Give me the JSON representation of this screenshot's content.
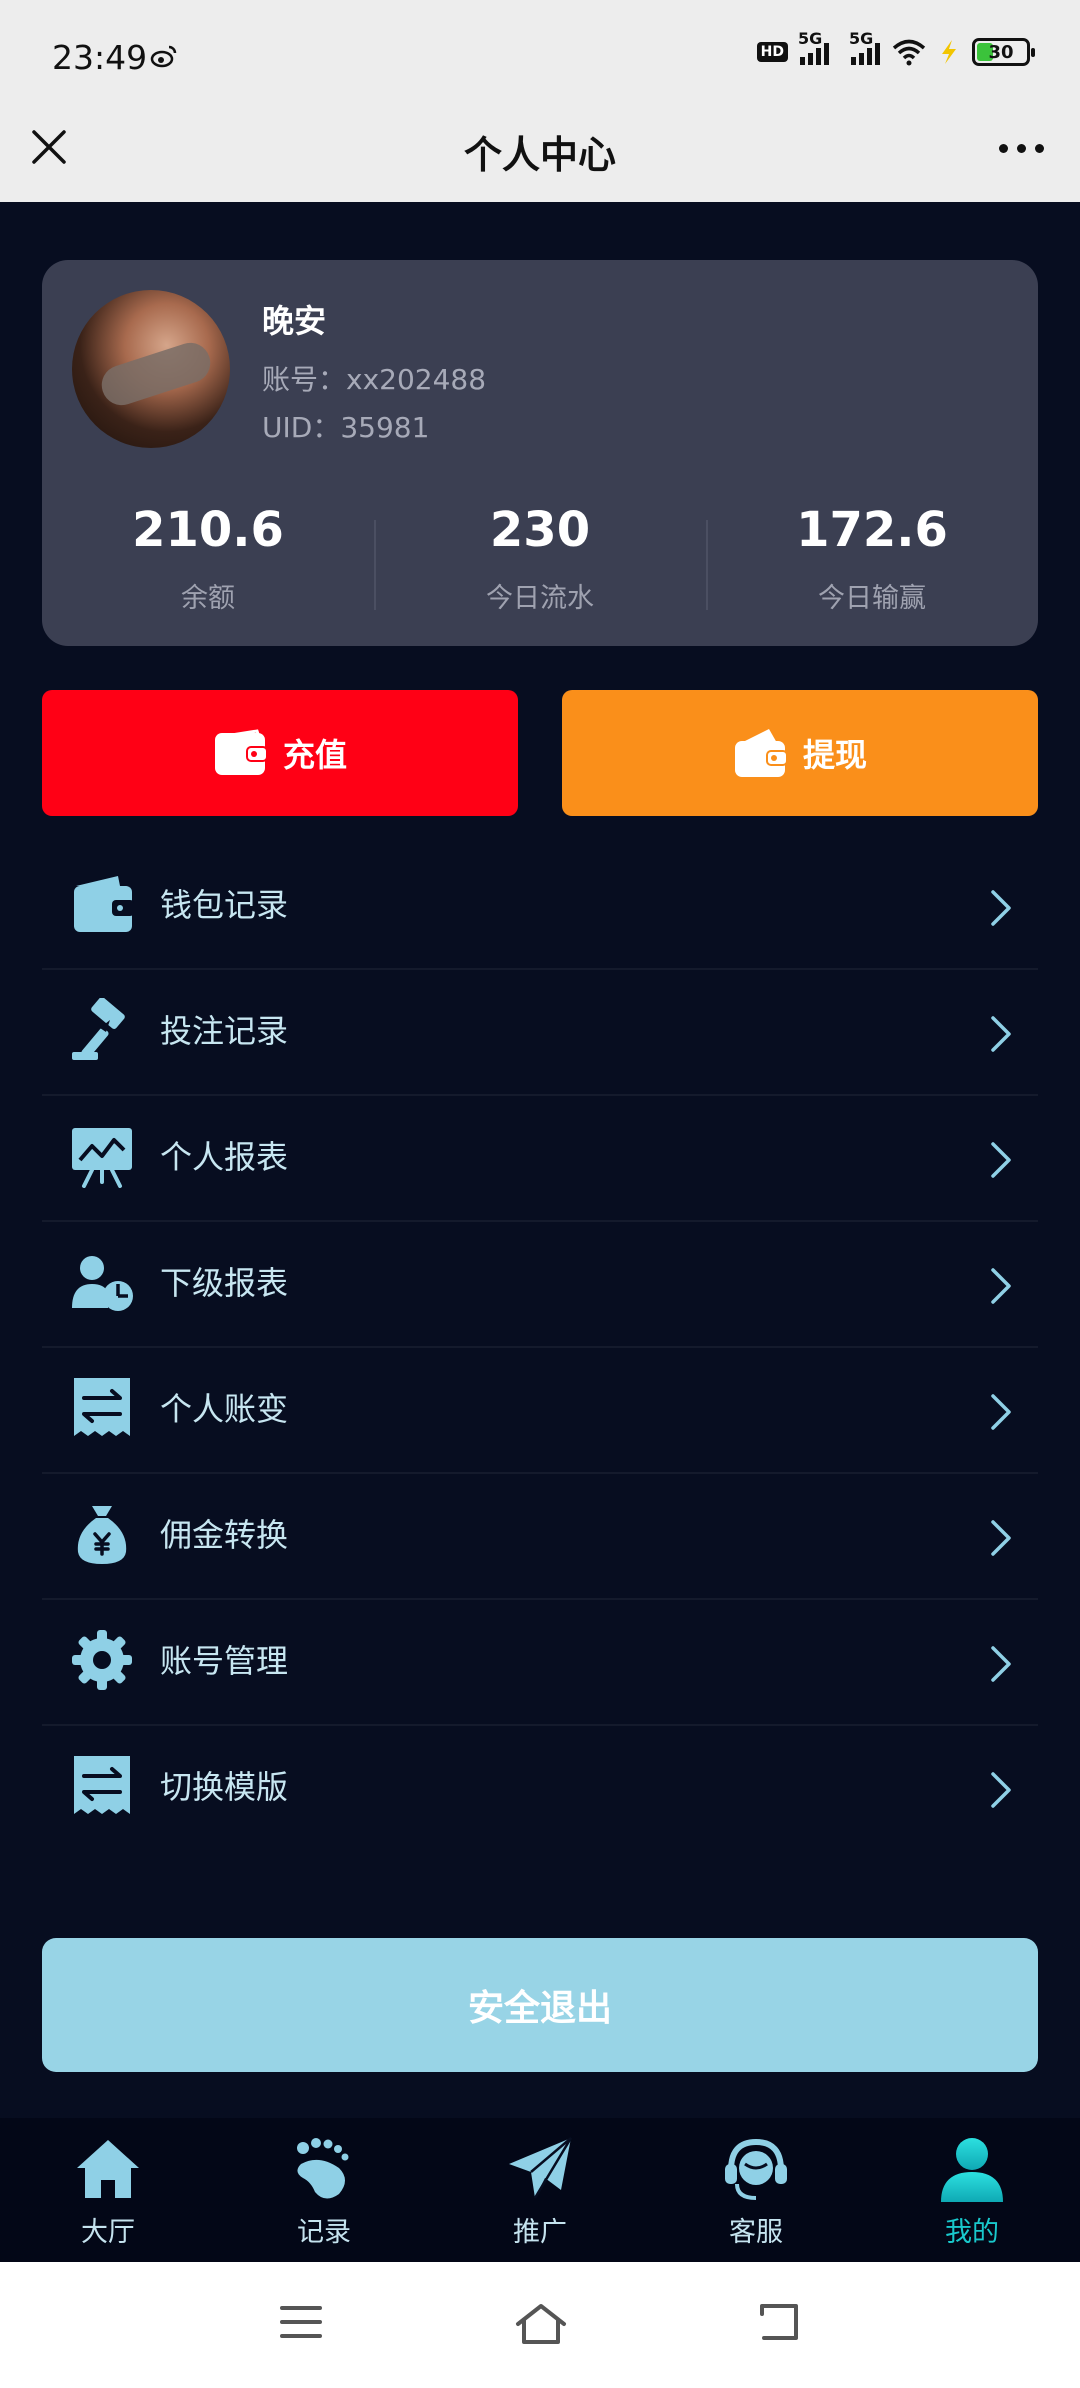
{
  "status_bar": {
    "time": "23:49",
    "battery_level": "30",
    "network": [
      "5G",
      "5G"
    ],
    "hd_label": "HD"
  },
  "nav": {
    "title": "个人中心",
    "close_icon": "close-icon",
    "more_icon": "more-icon"
  },
  "profile": {
    "nickname": "晚安",
    "account": "账号：xx202488",
    "uid": "UID：35981",
    "stats": [
      {
        "value": "210.6",
        "label": "余额"
      },
      {
        "value": "230",
        "label": "今日流水"
      },
      {
        "value": "172.6",
        "label": "今日输赢"
      }
    ]
  },
  "actions": {
    "recharge_label": "充值",
    "withdraw_label": "提现"
  },
  "menu": [
    {
      "label": "钱包记录",
      "icon": "wallet-icon"
    },
    {
      "label": "投注记录",
      "icon": "gavel-icon"
    },
    {
      "label": "个人报表",
      "icon": "chart-board-icon"
    },
    {
      "label": "下级报表",
      "icon": "user-pie-icon"
    },
    {
      "label": "个人账变",
      "icon": "transfer-receipt-icon"
    },
    {
      "label": "佣金转换",
      "icon": "money-bag-icon"
    },
    {
      "label": "账号管理",
      "icon": "gear-icon"
    },
    {
      "label": "切换模版",
      "icon": "switch-template-icon"
    }
  ],
  "logout_label": "安全退出",
  "tabs": [
    {
      "label": "大厅",
      "icon": "home-icon"
    },
    {
      "label": "记录",
      "icon": "footprint-icon"
    },
    {
      "label": "推广",
      "icon": "paper-plane-icon"
    },
    {
      "label": "客服",
      "icon": "headset-icon"
    },
    {
      "label": "我的",
      "icon": "user-icon",
      "active": true
    }
  ],
  "colors": {
    "background": "#070d20",
    "card": "#3b3f52",
    "recharge": "#ff0015",
    "withdraw": "#fa8f1a",
    "menu_icon": "#8fd0e6",
    "logout": "#98d4e6",
    "tab_active": "#19c8cc"
  }
}
